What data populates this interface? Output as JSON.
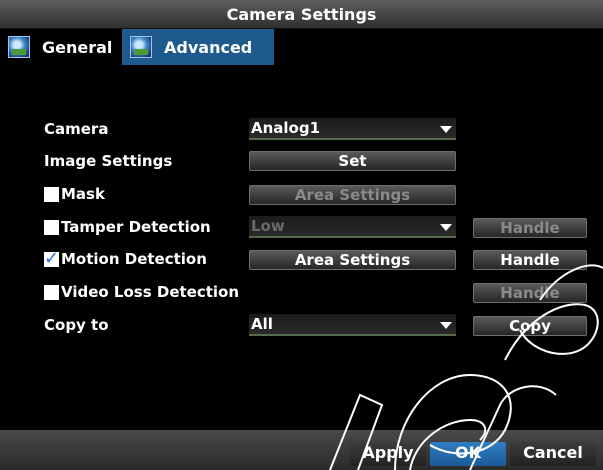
{
  "window": {
    "title": "Camera Settings"
  },
  "tabs": [
    {
      "label": "General",
      "icon": "camera-settings-icon"
    },
    {
      "label": "Advanced",
      "icon": "camera-settings-icon",
      "active": true
    }
  ],
  "form": {
    "camera": {
      "label": "Camera",
      "value": "Analog1"
    },
    "image_settings": {
      "label": "Image Settings",
      "button": "Set"
    },
    "mask": {
      "label": "Mask",
      "checked": false,
      "button": "Area Settings",
      "button_enabled": false
    },
    "tamper_detection": {
      "label": "Tamper Detection",
      "checked": false,
      "value": "Low",
      "handle": "Handle",
      "enabled": false
    },
    "motion_detection": {
      "label": "Motion Detection",
      "checked": true,
      "button": "Area Settings",
      "handle": "Handle",
      "enabled": true
    },
    "video_loss_detection": {
      "label": "Video Loss Detection",
      "checked": false,
      "handle": "Handle",
      "enabled": false
    },
    "copy_to": {
      "label": "Copy to",
      "value": "All",
      "button": "Copy"
    }
  },
  "footer": {
    "apply": "Apply",
    "ok": "OK",
    "cancel": "Cancel"
  },
  "colors": {
    "active_tab": "#1f5a8e",
    "ok_button": "#1b5a96",
    "checkbox_check": "#2b6fd6"
  }
}
